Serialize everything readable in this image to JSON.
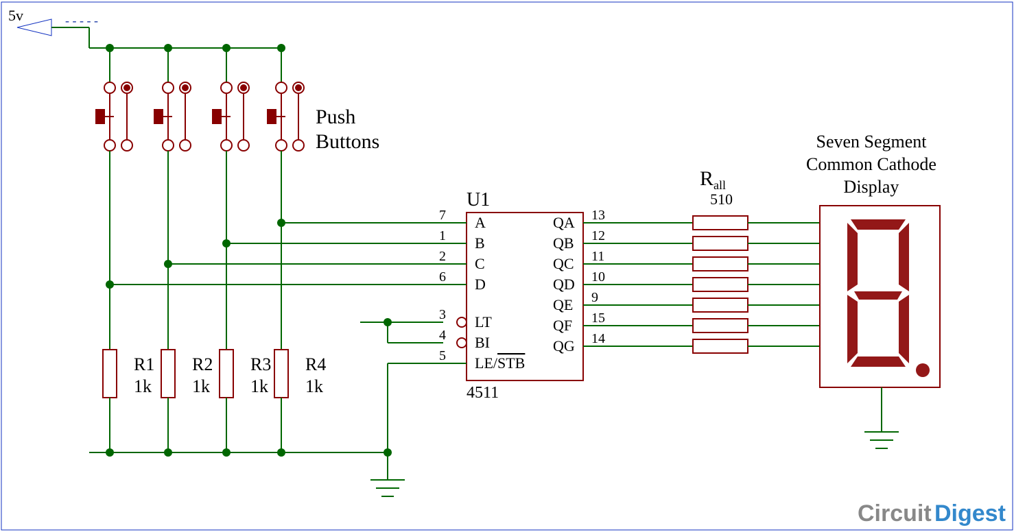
{
  "power": {
    "v": "5v"
  },
  "annotations": {
    "push_buttons_line1": "Push",
    "push_buttons_line2": "Buttons",
    "display_line1": "Seven Segment",
    "display_line2": "Common Cathode",
    "display_line3": "Display"
  },
  "resistors": {
    "r1": {
      "name": "R1",
      "value": "1k"
    },
    "r2": {
      "name": "R2",
      "value": "1k"
    },
    "r3": {
      "name": "R3",
      "value": "1k"
    },
    "r4": {
      "name": "R4",
      "value": "1k"
    },
    "rall": {
      "name": "R",
      "sub": "all",
      "value": "510"
    }
  },
  "ic": {
    "ref": "U1",
    "part": "4511",
    "pins_left": [
      {
        "num": "7",
        "name": "A"
      },
      {
        "num": "1",
        "name": "B"
      },
      {
        "num": "2",
        "name": "C"
      },
      {
        "num": "6",
        "name": "D"
      },
      {
        "num": "3",
        "name": "LT"
      },
      {
        "num": "4",
        "name": "BI"
      },
      {
        "num": "5",
        "name": "LE/STB"
      }
    ],
    "pins_right": [
      {
        "num": "13",
        "name": "QA"
      },
      {
        "num": "12",
        "name": "QB"
      },
      {
        "num": "11",
        "name": "QC"
      },
      {
        "num": "10",
        "name": "QD"
      },
      {
        "num": "9",
        "name": "QE"
      },
      {
        "num": "15",
        "name": "QF"
      },
      {
        "num": "14",
        "name": "QG"
      }
    ]
  },
  "watermark": {
    "a": "Circuit",
    "b": "Digest"
  }
}
